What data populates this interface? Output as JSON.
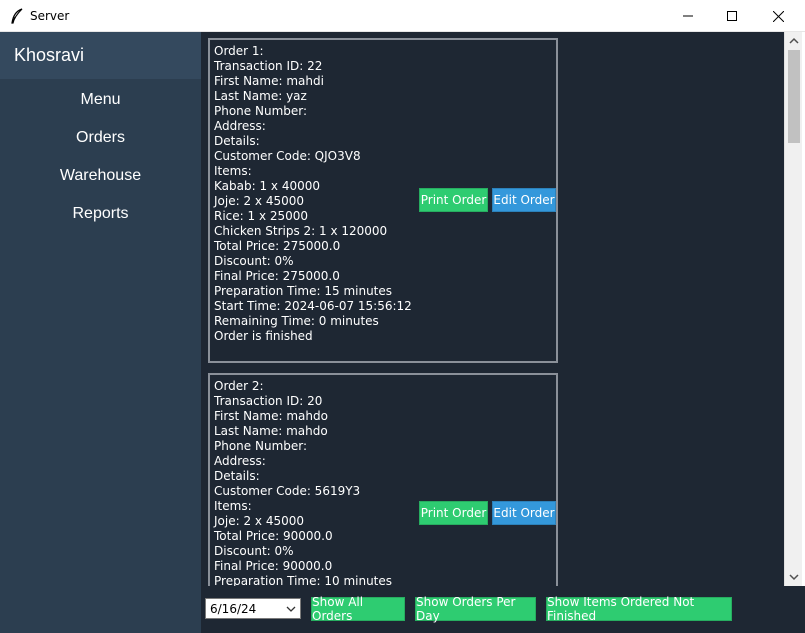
{
  "window": {
    "title": "Server",
    "icon": "feather-icon"
  },
  "sidebar": {
    "brand": "Khosravi",
    "items": [
      {
        "label": "Menu"
      },
      {
        "label": "Orders"
      },
      {
        "label": "Warehouse"
      },
      {
        "label": "Reports"
      }
    ]
  },
  "orders": [
    {
      "lines": [
        "Order 1:",
        "Transaction ID: 22",
        "First Name: mahdi",
        "Last Name: yaz",
        "Phone Number:",
        "Address:",
        "Details:",
        "Customer Code: QJO3V8",
        "Items:",
        "Kabab: 1 x 40000",
        "Joje: 2 x 45000",
        "Rice: 1 x 25000",
        "Chicken Strips 2: 1 x 120000",
        "Total Price: 275000.0",
        "Discount: 0%",
        "Final Price: 275000.0",
        "Preparation Time: 15 minutes",
        "Start Time: 2024-06-07 15:56:12",
        "Remaining Time: 0 minutes",
        "Order is finished"
      ],
      "print_label": "Print Order",
      "edit_label": "Edit Order"
    },
    {
      "lines": [
        "Order 2:",
        "Transaction ID: 20",
        "First Name: mahdo",
        "Last Name: mahdo",
        "Phone Number:",
        "Address:",
        "Details:",
        "Customer Code: 5619Y3",
        "Items:",
        "Joje: 2 x 45000",
        "Total Price: 90000.0",
        "Discount: 0%",
        "Final Price: 90000.0",
        "Preparation Time: 10 minutes"
      ],
      "print_label": "Print Order",
      "edit_label": "Edit Order"
    }
  ],
  "bottom": {
    "date_value": "6/16/24",
    "show_all": "Show All Orders",
    "show_per_day": "Show Orders Per Day",
    "show_not_finished": "Show Items Ordered Not Finished"
  },
  "colors": {
    "sidebar": "#2c3e50",
    "brand_bg": "#34495e",
    "content_bg": "#1e2733",
    "green": "#2ecc71",
    "blue": "#3498db"
  }
}
